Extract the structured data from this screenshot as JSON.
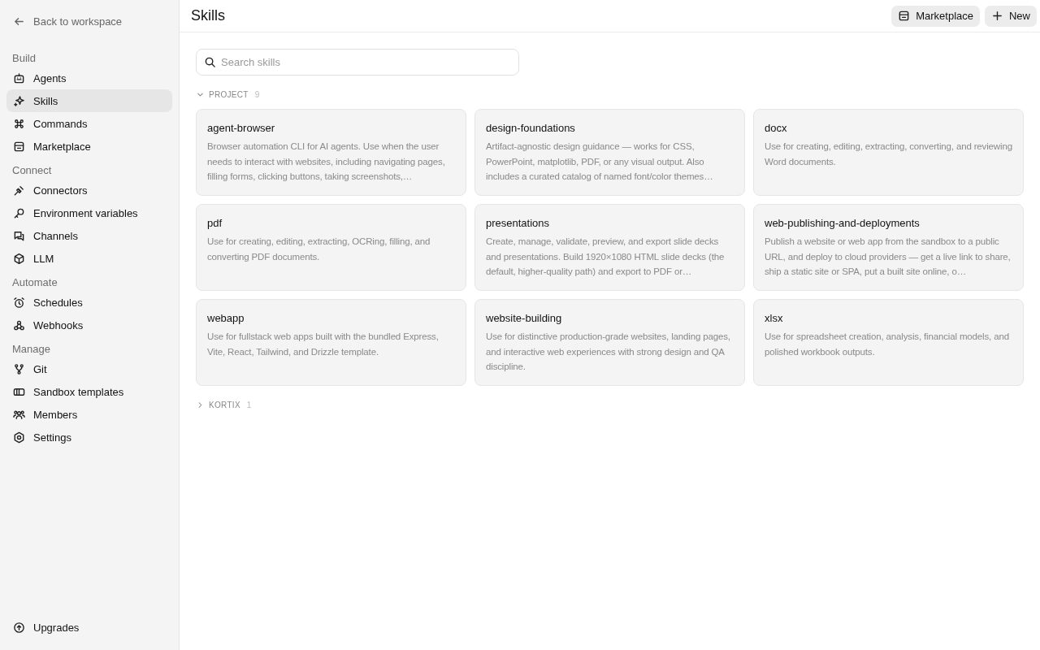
{
  "sidebar": {
    "back_link": "Back to workspace",
    "groups": [
      {
        "label": "Build",
        "items": [
          {
            "label": "Agents",
            "selected": false
          },
          {
            "label": "Skills",
            "selected": true
          },
          {
            "label": "Commands",
            "selected": false
          },
          {
            "label": "Marketplace",
            "selected": false
          }
        ]
      },
      {
        "label": "Connect",
        "items": [
          {
            "label": "Connectors",
            "selected": false
          },
          {
            "label": "Environment variables",
            "selected": false
          },
          {
            "label": "Channels",
            "selected": false
          },
          {
            "label": "LLM",
            "selected": false
          }
        ]
      },
      {
        "label": "Automate",
        "items": [
          {
            "label": "Schedules",
            "selected": false
          },
          {
            "label": "Webhooks",
            "selected": false
          }
        ]
      },
      {
        "label": "Manage",
        "items": [
          {
            "label": "Git",
            "selected": false
          },
          {
            "label": "Sandbox templates",
            "selected": false
          },
          {
            "label": "Members",
            "selected": false
          },
          {
            "label": "Settings",
            "selected": false
          }
        ]
      }
    ],
    "footer_item": "Upgrades"
  },
  "header": {
    "title": "Skills",
    "buttons": [
      {
        "label": "Marketplace",
        "kind": "store"
      },
      {
        "label": "New",
        "kind": "plus"
      }
    ]
  },
  "search": {
    "placeholder": "Search skills"
  },
  "sections": [
    {
      "label": "PROJECT",
      "count": "9",
      "expanded": true,
      "skills": [
        {
          "name": "agent-browser",
          "description": "Browser automation CLI for AI agents. Use when the user needs to interact with websites, including navigating pages, filling forms, clicking buttons, taking screenshots,…"
        },
        {
          "name": "design-foundations",
          "description": "Artifact-agnostic design guidance — works for CSS, PowerPoint, matplotlib, PDF, or any visual output. Also includes a curated catalog of named font/color themes…"
        },
        {
          "name": "docx",
          "description": "Use for creating, editing, extracting, converting, and reviewing Word documents."
        },
        {
          "name": "pdf",
          "description": "Use for creating, editing, extracting, OCRing, filling, and converting PDF documents."
        },
        {
          "name": "presentations",
          "description": "Create, manage, validate, preview, and export slide decks and presentations. Build 1920×1080 HTML slide decks (the default, higher-quality path) and export to PDF or…"
        },
        {
          "name": "web-publishing-and-deployments",
          "description": "Publish a website or web app from the sandbox to a public URL, and deploy to cloud providers — get a live link to share, ship a static site or SPA, put a built site online, o…"
        },
        {
          "name": "webapp",
          "description": "Use for fullstack web apps built with the bundled Express, Vite, React, Tailwind, and Drizzle template."
        },
        {
          "name": "website-building",
          "description": "Use for distinctive production-grade websites, landing pages, and interactive web experiences with strong design and QA discipline."
        },
        {
          "name": "xlsx",
          "description": "Use for spreadsheet creation, analysis, financial models, and polished workbook outputs."
        }
      ]
    },
    {
      "label": "KORTIX",
      "count": "1",
      "expanded": false
    }
  ]
}
